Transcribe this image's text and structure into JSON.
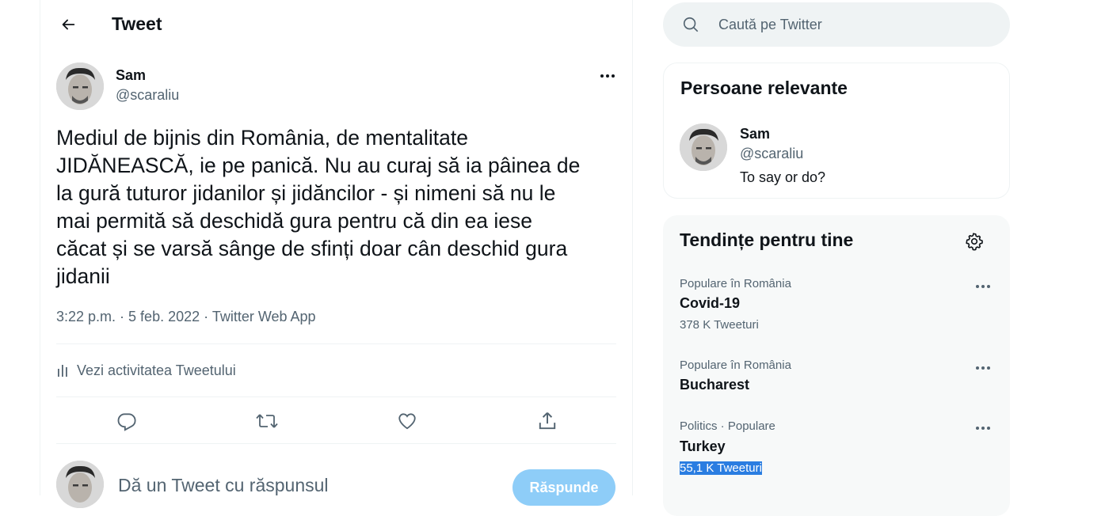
{
  "header": {
    "title": "Tweet",
    "back_icon": "arrow-left-icon"
  },
  "tweet": {
    "author_name": "Sam",
    "author_handle": "@scaraliu",
    "text": "Mediul de bijnis din România, de mentalitate\nJIDĂNEASCĂ, ie pe panică. Nu au curaj să ia pâinea de\nla gură tuturor jidanilor și jidăncilor - și nimeni să nu le\nmai permită să deschidă gura pentru că din ea iese\ncăcat și se varsă sânge de sfinți doar cân deschid gura\njidanii",
    "time": "3:22 p.m.",
    "date": "5 feb. 2022",
    "source": "Twitter Web App",
    "activity_label": "Vezi activitatea Tweetului"
  },
  "reply": {
    "placeholder": "Dă un Tweet cu răspunsul",
    "button_label": "Răspunde"
  },
  "search": {
    "placeholder": "Caută pe Twitter"
  },
  "relevant_people": {
    "title": "Persoane relevante",
    "name": "Sam",
    "handle": "@scaraliu",
    "bio": "To say or do?"
  },
  "trends": {
    "title": "Tendințe pentru tine",
    "items": [
      {
        "context": "Populare în România",
        "name": "Covid-19",
        "count": "378 K Tweeturi"
      },
      {
        "context": "Populare în România",
        "name": "Bucharest",
        "count": ""
      },
      {
        "context": "Politics · Populare",
        "name": "Turkey",
        "count": "55,1 K Tweeturi"
      }
    ]
  },
  "colors": {
    "accent": "#1d9bf0",
    "reply_button_disabled": "#8ecdf8",
    "secondary_text": "#536471",
    "selection": "#2a7de1"
  }
}
